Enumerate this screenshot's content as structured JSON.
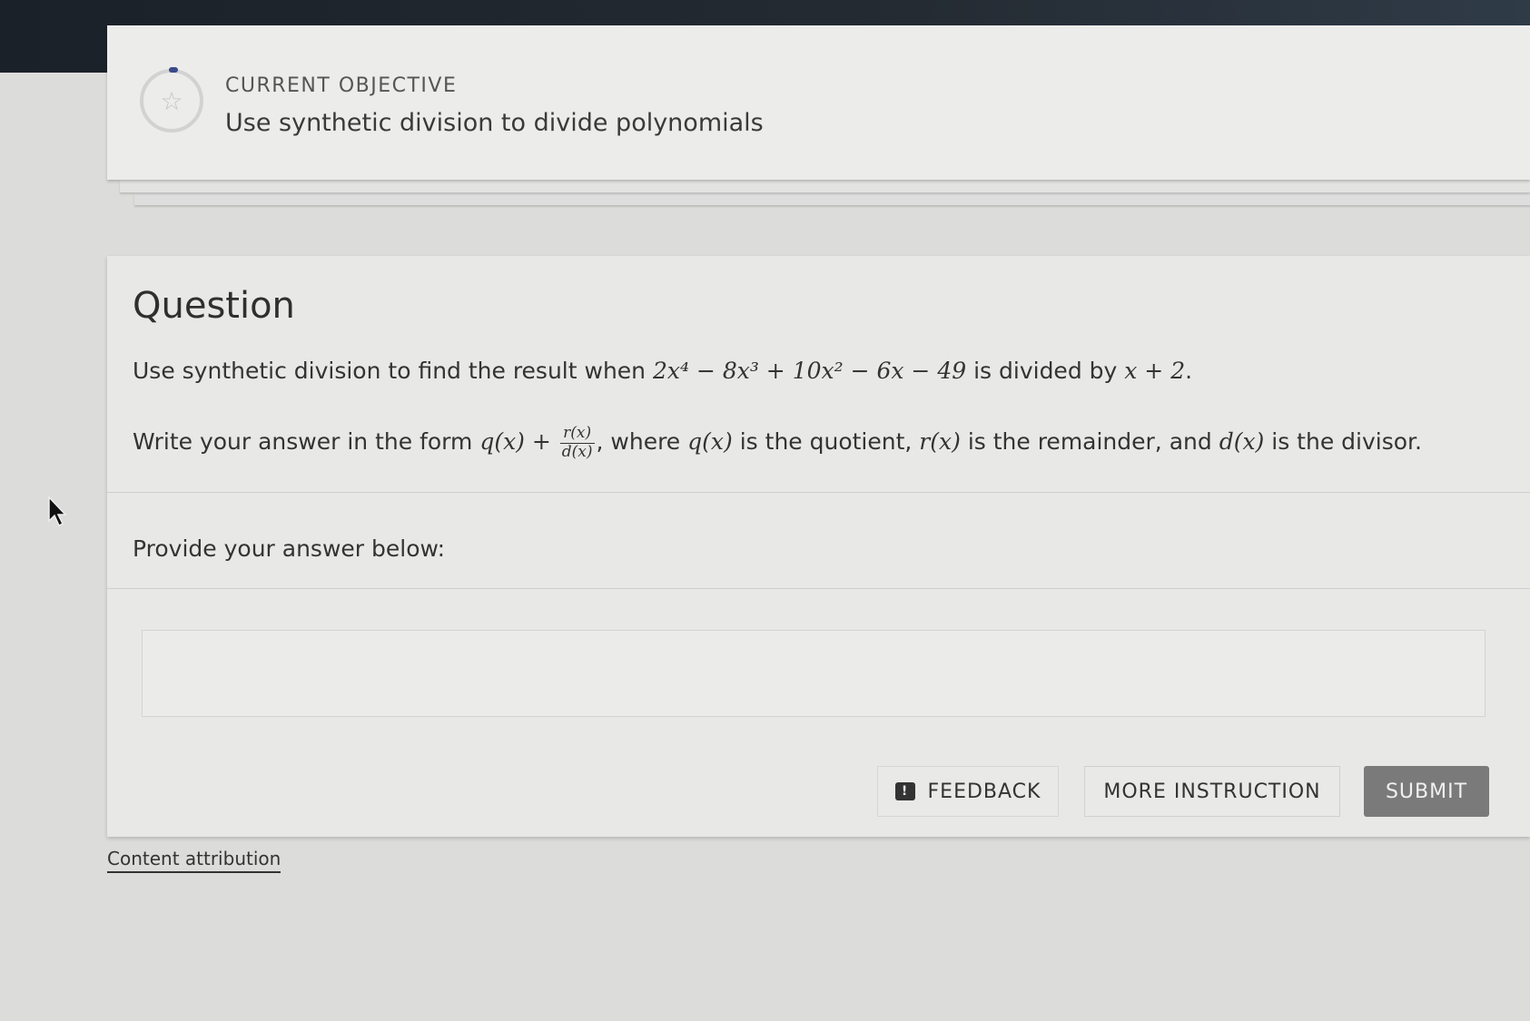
{
  "objective": {
    "label": "CURRENT OBJECTIVE",
    "title": "Use synthetic division to divide polynomials",
    "badge_icon": "star-icon"
  },
  "question": {
    "heading": "Question",
    "line1_prefix": "Use synthetic division to find the result when",
    "dividend": "2x⁴ − 8x³ + 10x² − 6x − 49",
    "line1_mid": "is divided by",
    "divisor": "x + 2",
    "line1_end": ".",
    "line2_prefix": "Write your answer in the form",
    "form_q": "q(x) +",
    "form_num": "r(x)",
    "form_den": "d(x)",
    "line2_where": ", where",
    "q_sym": "q(x)",
    "q_desc": "is the quotient,",
    "r_sym": "r(x)",
    "r_desc": "is the remainder, and",
    "d_sym": "d(x)",
    "d_desc": "is the divisor."
  },
  "answer": {
    "label": "Provide your answer below:",
    "value": "",
    "placeholder": ""
  },
  "buttons": {
    "feedback": "FEEDBACK",
    "feedback_icon": "feedback-icon",
    "more_instruction": "MORE INSTRUCTION",
    "submit": "SUBMIT"
  },
  "footer": {
    "attribution": "Content attribution"
  }
}
